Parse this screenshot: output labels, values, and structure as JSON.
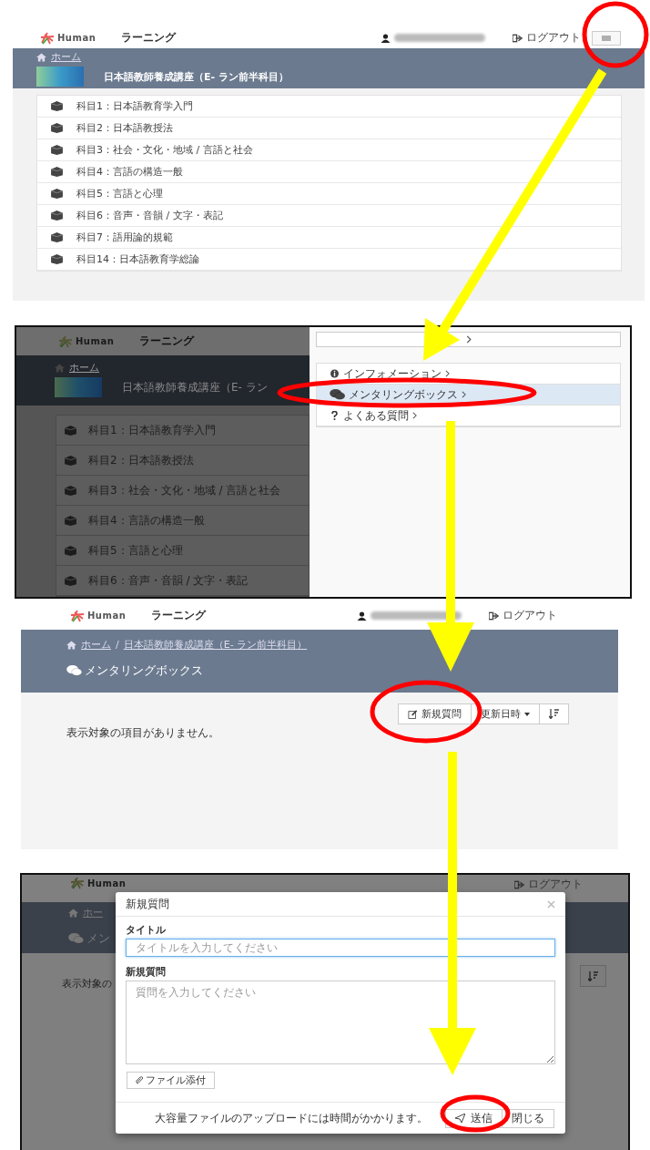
{
  "step1": {
    "header": {
      "logo": "Human",
      "app_name": "ラーニング",
      "logout": "ログアウト"
    },
    "breadcrumb": "ホーム",
    "course_title": "日本語教師養成講座（E- ラン前半科目）",
    "subjects": [
      "科目1：日本語教育学入門",
      "科目2：日本語教授法",
      "科目3：社会・文化・地域 / 言語と社会",
      "科目4：言語の構造一般",
      "科目5：言語と心理",
      "科目6：音声・音韻 / 文字・表記",
      "科目7：語用論的規範",
      "科目14：日本語教育学総論"
    ]
  },
  "step2": {
    "header": {
      "logo": "Human",
      "app_name": "ラーニング"
    },
    "breadcrumb": "ホーム",
    "course_title": "日本語教師養成講座（E- ラン",
    "subjects": [
      "科目1：日本語教育学入門",
      "科目2：日本語教授法",
      "科目3：社会・文化・地域 / 言語と社会",
      "科目4：言語の構造一般",
      "科目5：言語と心理",
      "科目6：音声・音韻 / 文字・表記"
    ],
    "drawer": {
      "items": [
        {
          "kind": "info",
          "label": "インフォメーション",
          "selected": false
        },
        {
          "kind": "chat",
          "label": "メンタリングボックス",
          "selected": true
        },
        {
          "kind": "faq",
          "label": "よくある質問",
          "selected": false
        }
      ]
    }
  },
  "step3": {
    "header": {
      "logo": "Human",
      "app_name": "ラーニング",
      "logout": "ログアウト"
    },
    "breadcrumb": {
      "items": [
        "ホーム",
        "日本語教師養成講座（E- ラン前半科目）"
      ],
      "separator": "/"
    },
    "page_title": "メンタリングボックス",
    "toolbar": {
      "new_question": "新規質問",
      "sort_field": "更新日時"
    },
    "empty_message": "表示対象の項目がありません。"
  },
  "step4": {
    "background": {
      "logo": "Human",
      "logout": "ログアウト",
      "breadcrumb": "ホー",
      "page_title": "メン",
      "empty_message": "表示対象の"
    },
    "dialog": {
      "title": "新規質問",
      "title_label": "タイトル",
      "title_placeholder": "タイトルを入力してください",
      "body_label": "新規質問",
      "body_placeholder": "質問を入力してください",
      "attach": "ファイル添付",
      "notice": "大容量ファイルのアップロードには時間がかかります。",
      "send": "送信",
      "close": "閉じる"
    }
  }
}
